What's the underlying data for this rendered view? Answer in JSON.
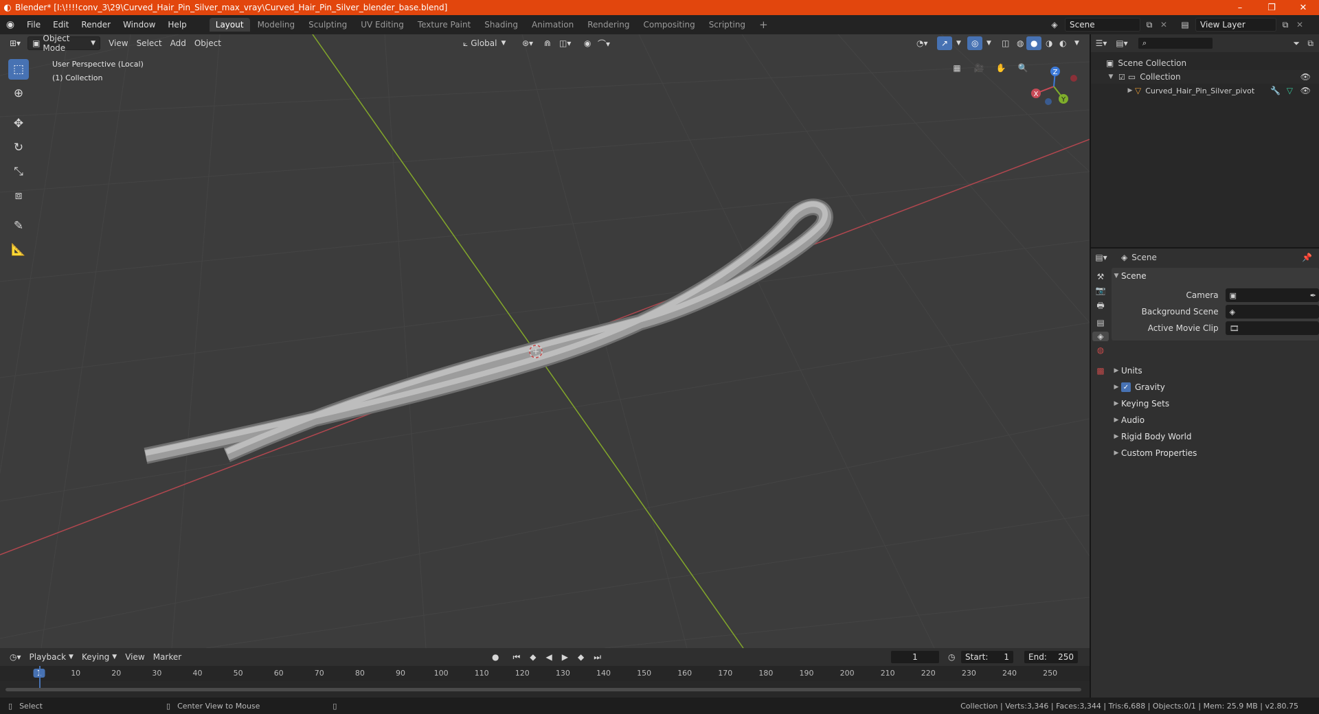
{
  "titlebar": {
    "title": "Blender* [I:\\!!!!conv_3\\29\\Curved_Hair_Pin_Silver_max_vray\\Curved_Hair_Pin_Silver_blender_base.blend]",
    "minimize": "–",
    "maximize": "❐",
    "close": "✕"
  },
  "menu": [
    "File",
    "Edit",
    "Render",
    "Window",
    "Help"
  ],
  "workspaces": [
    "Layout",
    "Modeling",
    "Sculpting",
    "UV Editing",
    "Texture Paint",
    "Shading",
    "Animation",
    "Rendering",
    "Compositing",
    "Scripting"
  ],
  "active_workspace": "Layout",
  "scene_field": "Scene",
  "view_layer_field": "View Layer",
  "viewport": {
    "mode": "Object Mode",
    "menus": [
      "View",
      "Select",
      "Add",
      "Object"
    ],
    "transform_orientation": "Global",
    "overlay_line1": "User Perspective (Local)",
    "overlay_line2": "(1) Collection",
    "gizmo": {
      "x": "X",
      "y": "Y",
      "z": "Z"
    }
  },
  "outliner": {
    "search_placeholder": "",
    "root": "Scene Collection",
    "collection": "Collection",
    "object": "Curved_Hair_Pin_Silver_pivot"
  },
  "properties": {
    "header": "Scene",
    "panel": "Scene",
    "rows": [
      {
        "label": "Camera",
        "value": ""
      },
      {
        "label": "Background Scene",
        "value": ""
      },
      {
        "label": "Active Movie Clip",
        "value": ""
      }
    ],
    "subpanels": [
      "Units",
      "Gravity",
      "Keying Sets",
      "Audio",
      "Rigid Body World",
      "Custom Properties"
    ],
    "gravity_checked": true
  },
  "timeline": {
    "menus": [
      "Playback",
      "Keying",
      "View",
      "Marker"
    ],
    "current_frame": "1",
    "start_label": "Start:",
    "start_value": "1",
    "end_label": "End:",
    "end_value": "250",
    "ruler": [
      "1",
      "10",
      "20",
      "30",
      "40",
      "50",
      "60",
      "70",
      "80",
      "90",
      "100",
      "110",
      "120",
      "130",
      "140",
      "150",
      "160",
      "170",
      "180",
      "190",
      "200",
      "210",
      "220",
      "230",
      "240",
      "250"
    ]
  },
  "statusbar": {
    "left": "Select",
    "middle": "Center View to Mouse",
    "right": "Collection | Verts:3,346 | Faces:3,344 | Tris:6,688 | Objects:0/1 | Mem: 25.9 MB | v2.80.75"
  },
  "colors": {
    "title_bar": "#e2460d",
    "accent_blue": "#4772b3",
    "axis_red": "#b2474f",
    "axis_green": "#83a82a",
    "viewport_bg": "#3c3c3c"
  }
}
